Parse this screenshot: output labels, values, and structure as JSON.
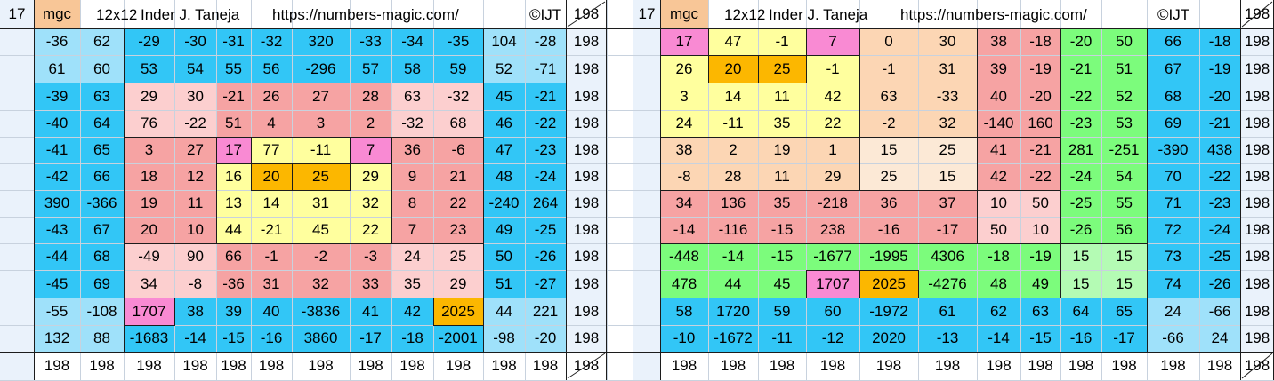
{
  "colors": {
    "sky": "#9fe1fa",
    "blue": "#32c6f6",
    "pink": "#fccfcf",
    "red": "#f6a3a3",
    "yellow": "#ffff9e",
    "orange": "#fcb700",
    "magenta": "#f98ad3",
    "peach": "#fcd6b4",
    "cream": "#fce9d6",
    "green": "#7cfc7c",
    "lightgreen": "#b4fbb4",
    "tan": "#f8c697"
  },
  "panels": [
    {
      "header": {
        "order": "17",
        "mgc": "mgc",
        "size": "12x12",
        "author": "Inder J. Taneja",
        "url": "https://numbers-magic.com/",
        "copyright": "©IJT",
        "diag_sum": "198"
      },
      "rows": [
        [
          "-36",
          "62",
          "-29",
          "-30",
          "-31",
          "-32",
          "320",
          "-33",
          "-34",
          "-35",
          "104",
          "-28"
        ],
        [
          "61",
          "60",
          "53",
          "54",
          "55",
          "56",
          "-296",
          "57",
          "58",
          "59",
          "52",
          "-71"
        ],
        [
          "-39",
          "63",
          "29",
          "30",
          "-21",
          "26",
          "27",
          "28",
          "63",
          "-32",
          "45",
          "-21"
        ],
        [
          "-40",
          "64",
          "76",
          "-22",
          "51",
          "4",
          "3",
          "2",
          "-32",
          "68",
          "46",
          "-22"
        ],
        [
          "-41",
          "65",
          "3",
          "27",
          "17",
          "77",
          "-11",
          "7",
          "36",
          "-6",
          "47",
          "-23"
        ],
        [
          "-42",
          "66",
          "18",
          "12",
          "16",
          "20",
          "25",
          "29",
          "9",
          "21",
          "48",
          "-24"
        ],
        [
          "390",
          "-366",
          "19",
          "11",
          "13",
          "14",
          "31",
          "32",
          "8",
          "22",
          "-240",
          "264"
        ],
        [
          "-43",
          "67",
          "20",
          "10",
          "44",
          "-21",
          "45",
          "22",
          "7",
          "23",
          "49",
          "-25"
        ],
        [
          "-44",
          "68",
          "-49",
          "90",
          "66",
          "-1",
          "-2",
          "-3",
          "24",
          "25",
          "50",
          "-26"
        ],
        [
          "-45",
          "69",
          "34",
          "-8",
          "-36",
          "31",
          "32",
          "33",
          "35",
          "29",
          "51",
          "-27"
        ],
        [
          "-55",
          "-108",
          "1707",
          "38",
          "39",
          "40",
          "-3836",
          "41",
          "42",
          "2025",
          "44",
          "221"
        ],
        [
          "132",
          "88",
          "-1683",
          "-14",
          "-15",
          "-16",
          "3860",
          "-17",
          "-18",
          "-2001",
          "-98",
          "-20"
        ]
      ],
      "row_sums": [
        "198",
        "198",
        "198",
        "198",
        "198",
        "198",
        "198",
        "198",
        "198",
        "198",
        "198",
        "198"
      ],
      "col_sums": [
        "198",
        "198",
        "198",
        "198",
        "198",
        "198",
        "198",
        "198",
        "198",
        "198",
        "198",
        "198"
      ],
      "corner_sum": "198"
    },
    {
      "header": {
        "order": "17",
        "mgc": "mgc",
        "size": "12x12",
        "author": "Inder J. Taneja",
        "url": "https://numbers-magic.com/",
        "copyright": "©IJT",
        "diag_sum": "198"
      },
      "rows": [
        [
          "17",
          "47",
          "-1",
          "7",
          "0",
          "30",
          "38",
          "-18",
          "-20",
          "50",
          "66",
          "-18"
        ],
        [
          "26",
          "20",
          "25",
          "-1",
          "-1",
          "31",
          "39",
          "-19",
          "-21",
          "51",
          "67",
          "-19"
        ],
        [
          "3",
          "14",
          "11",
          "42",
          "63",
          "-33",
          "40",
          "-20",
          "-22",
          "52",
          "68",
          "-20"
        ],
        [
          "24",
          "-11",
          "35",
          "22",
          "-2",
          "32",
          "-140",
          "160",
          "-23",
          "53",
          "69",
          "-21"
        ],
        [
          "38",
          "2",
          "19",
          "1",
          "15",
          "25",
          "41",
          "-21",
          "281",
          "-251",
          "-390",
          "438"
        ],
        [
          "-8",
          "28",
          "11",
          "29",
          "25",
          "15",
          "42",
          "-22",
          "-24",
          "54",
          "70",
          "-22"
        ],
        [
          "34",
          "136",
          "35",
          "-218",
          "36",
          "37",
          "10",
          "50",
          "-25",
          "55",
          "71",
          "-23"
        ],
        [
          "-14",
          "-116",
          "-15",
          "238",
          "-16",
          "-17",
          "50",
          "10",
          "-26",
          "56",
          "72",
          "-24"
        ],
        [
          "-448",
          "-14",
          "-15",
          "-1677",
          "-1995",
          "4306",
          "-18",
          "-19",
          "15",
          "15",
          "73",
          "-25"
        ],
        [
          "478",
          "44",
          "45",
          "1707",
          "2025",
          "-4276",
          "48",
          "49",
          "15",
          "15",
          "74",
          "-26"
        ],
        [
          "58",
          "1720",
          "59",
          "60",
          "-1972",
          "61",
          "62",
          "63",
          "64",
          "65",
          "24",
          "-66"
        ],
        [
          "-10",
          "-1672",
          "-11",
          "-12",
          "2020",
          "-13",
          "-14",
          "-15",
          "-16",
          "-17",
          "-66",
          "24"
        ]
      ],
      "row_sums": [
        "198",
        "198",
        "198",
        "198",
        "198",
        "198",
        "198",
        "198",
        "198",
        "198",
        "198",
        "198"
      ],
      "col_sums": [
        "198",
        "198",
        "198",
        "198",
        "198",
        "198",
        "198",
        "198",
        "198",
        "198",
        "198",
        "198"
      ],
      "corner_sum": "198"
    }
  ]
}
